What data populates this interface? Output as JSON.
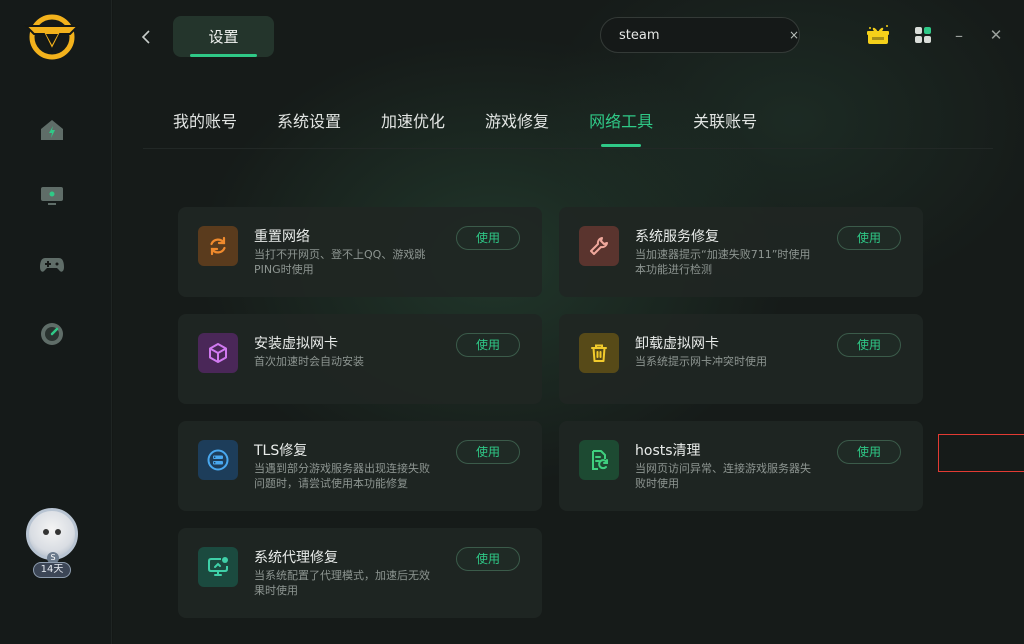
{
  "header": {
    "back_icon": "chevron-left-icon",
    "page_title": "设置",
    "search": {
      "value": "steam",
      "placeholder": "",
      "clear": "×"
    },
    "gift_icon": "gift-box-icon",
    "apps_icon": "apps-grid-icon",
    "minimize": "–",
    "close": "✕"
  },
  "sidebar": {
    "logo_icon": "shield-v-logo-icon",
    "items": [
      {
        "icon": "home-icon"
      },
      {
        "icon": "monitor-icon"
      },
      {
        "icon": "gamepad-icon"
      },
      {
        "icon": "speedometer-icon"
      }
    ],
    "user": {
      "level": "S",
      "days": "14天"
    }
  },
  "tabs": [
    {
      "label": "我的账号",
      "active": false
    },
    {
      "label": "系统设置",
      "active": false
    },
    {
      "label": "加速优化",
      "active": false
    },
    {
      "label": "游戏修复",
      "active": false
    },
    {
      "label": "网络工具",
      "active": true
    },
    {
      "label": "关联账号",
      "active": false
    }
  ],
  "tools": [
    {
      "title": "重置网络",
      "desc": "当打不开网页、登不上QQ、游戏跳PING时使用",
      "button": "使用",
      "icon": "refresh-icon",
      "color": "#f08a2d",
      "bg": "#5a3b1d"
    },
    {
      "title": "系统服务修复",
      "desc": "当加速器提示“加速失败711”时使用本功能进行检测",
      "button": "使用",
      "icon": "wrench-icon",
      "color": "#f0a89c",
      "bg": "#5a342e"
    },
    {
      "title": "安装虚拟网卡",
      "desc": "首次加速时会自动安装",
      "button": "使用",
      "icon": "cube-icon",
      "color": "#d079f0",
      "bg": "#4a2758"
    },
    {
      "title": "卸载虚拟网卡",
      "desc": "当系统提示网卡冲突时使用",
      "button": "使用",
      "icon": "trash-icon",
      "color": "#f2cb2c",
      "bg": "#574a18"
    },
    {
      "title": "TLS修复",
      "desc": "当遇到部分游戏服务器出现连接失败问题时，请尝试使用本功能修复",
      "button": "使用",
      "icon": "server-icon",
      "color": "#49a8ef",
      "bg": "#1d3d5a"
    },
    {
      "title": "hosts清理",
      "desc": "当网页访问异常、连接游戏服务器失败时使用",
      "button": "使用",
      "icon": "file-sync-icon",
      "color": "#3fd07f",
      "bg": "#1d4a32"
    },
    {
      "title": "系统代理修复",
      "desc": "当系统配置了代理模式，加速后无效果时使用",
      "button": "使用",
      "icon": "monitor-plus-icon",
      "color": "#3fd0a8",
      "bg": "#1b4a3f"
    }
  ]
}
